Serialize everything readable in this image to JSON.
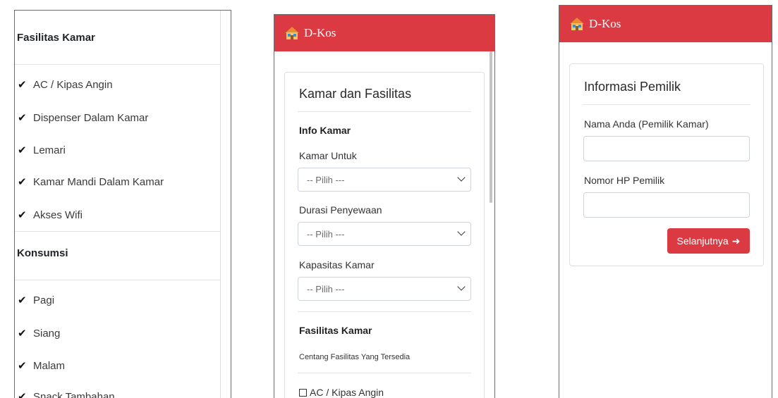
{
  "panel1": {
    "fasilitas_title": "Fasilitas Kamar",
    "fasilitas_items": [
      "AC / Kipas Angin",
      "Dispenser Dalam Kamar",
      "Lemari",
      "Kamar Mandi Dalam Kamar",
      "Akses Wifi"
    ],
    "konsumsi_title": "Konsumsi",
    "konsumsi_items": [
      "Pagi",
      "Siang",
      "Malam",
      "Snack Tambahan"
    ],
    "check_glyph": "✔"
  },
  "panel2": {
    "brand": "D-Kos",
    "card_title": "Kamar dan Fasilitas",
    "info_heading": "Info Kamar",
    "kamar_untuk_label": "Kamar Untuk",
    "kamar_untuk_value": "-- Pilih ---",
    "durasi_label": "Durasi Penyewaan",
    "durasi_value": "-- Pilih ---",
    "kapasitas_label": "Kapasitas Kamar",
    "kapasitas_value": "-- Pilih ---",
    "fasilitas_heading": "Fasilitas Kamar",
    "fasilitas_hint": "Centang Fasilitas Yang Tersedia",
    "first_checkbox_label": "AC / Kipas Angin"
  },
  "panel3": {
    "brand": "D-Kos",
    "card_title": "Informasi Pemilik",
    "nama_label": "Nama Anda (Pemilik Kamar)",
    "nama_value": "",
    "hp_label": "Nomor HP Pemilik",
    "hp_value": "",
    "next_button": "Selanjutnya",
    "arrow_glyph": "➜"
  },
  "colors": {
    "brand_red": "#dc3a42",
    "white": "#ffffff",
    "border": "#ced4da"
  },
  "icons": [
    "house-icon",
    "check-icon",
    "chevron-down-icon",
    "arrow-right-icon"
  ]
}
